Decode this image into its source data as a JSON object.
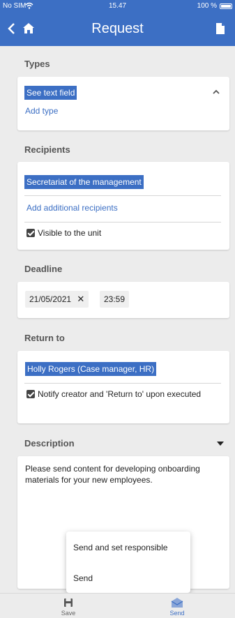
{
  "status": {
    "carrier": "No SIM",
    "time": "15.47",
    "battery": "100 %"
  },
  "nav": {
    "title": "Request"
  },
  "types": {
    "label": "Types",
    "selected": "See text field",
    "add_link": "Add type"
  },
  "recipients": {
    "label": "Recipients",
    "selected": "Secretariat of the management",
    "add_link": "Add additional recipients",
    "visible_label": "Visible to the unit",
    "visible_checked": true
  },
  "deadline": {
    "label": "Deadline",
    "date": "21/05/2021",
    "clear": "✕",
    "time": "23:59"
  },
  "return_to": {
    "label": "Return to",
    "selected": "Holly Rogers (Case manager, HR)",
    "notify_label": "Notify creator and 'Return to' upon executed",
    "notify_checked": true
  },
  "description": {
    "label": "Description",
    "text": "Please send content for developing onboarding materials for your new employees."
  },
  "send_menu": {
    "items": [
      "Send and set responsible",
      "Send"
    ]
  },
  "toolbar": {
    "save": "Save",
    "send": "Send"
  },
  "colors": {
    "accent": "#3c6fc4",
    "background": "#ececec"
  },
  "icons": [
    "wifi-icon",
    "battery-icon",
    "back-icon",
    "home-icon",
    "document-icon",
    "chevron-up-icon",
    "caret-down-icon",
    "checkbox-icon",
    "save-icon",
    "send-icon"
  ]
}
